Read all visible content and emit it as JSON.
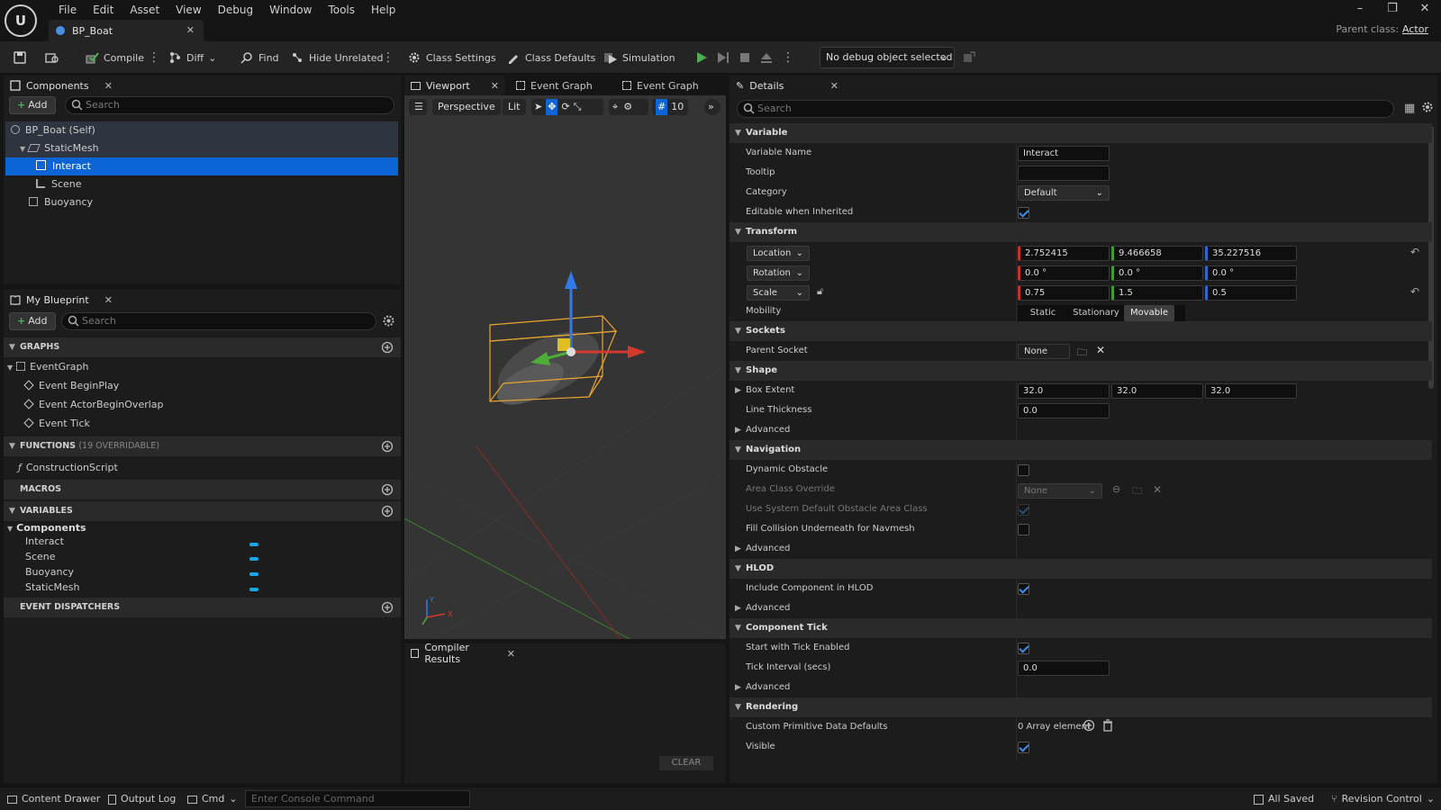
{
  "menu": [
    "File",
    "Edit",
    "Asset",
    "View",
    "Debug",
    "Window",
    "Tools",
    "Help"
  ],
  "document_tab": "BP_Boat",
  "parent_class": {
    "label": "Parent class:",
    "value": "Actor"
  },
  "toolbar": {
    "compile": "Compile",
    "diff": "Diff",
    "find": "Find",
    "hide_unrelated": "Hide Unrelated",
    "class_settings": "Class Settings",
    "class_defaults": "Class Defaults",
    "simulation": "Simulation",
    "debug_object": "No debug object selected"
  },
  "components": {
    "tab": "Components",
    "add": "Add",
    "search_placeholder": "Search",
    "tree": [
      {
        "label": "BP_Boat (Self)"
      },
      {
        "label": "StaticMesh"
      },
      {
        "label": "Interact"
      },
      {
        "label": "Scene"
      },
      {
        "label": "Buoyancy"
      }
    ]
  },
  "my_blueprint": {
    "tab": "My Blueprint",
    "add": "Add",
    "search_placeholder": "Search",
    "graphs": "GRAPHS",
    "event_graph": "EventGraph",
    "events": [
      "Event BeginPlay",
      "Event ActorBeginOverlap",
      "Event Tick"
    ],
    "functions": "FUNCTIONS",
    "functions_count": "(19 OVERRIDABLE)",
    "construction": "ConstructionScript",
    "macros": "MACROS",
    "variables": "VARIABLES",
    "components_group": "Components",
    "vars": [
      "Interact",
      "Scene",
      "Buoyancy",
      "StaticMesh"
    ],
    "event_dispatchers": "EVENT DISPATCHERS"
  },
  "center_tabs": [
    "Viewport",
    "Event Graph",
    "Event Graph"
  ],
  "viewport": {
    "perspective": "Perspective",
    "lit": "Lit",
    "grid_size": "10",
    "axis_x": "X",
    "axis_y": "Y"
  },
  "compiler": {
    "tab": "Compiler Results",
    "clear": "CLEAR"
  },
  "details": {
    "tab": "Details",
    "search_placeholder": "Search",
    "variable": "Variable",
    "variable_name_label": "Variable Name",
    "variable_name": "Interact",
    "tooltip_label": "Tooltip",
    "category_label": "Category",
    "category": "Default",
    "editable_label": "Editable when Inherited",
    "transform": "Transform",
    "location": "Location",
    "loc": [
      "2.752415",
      "9.466658",
      "35.227516"
    ],
    "rotation": "Rotation",
    "rot": [
      "0.0 °",
      "0.0 °",
      "0.0 °"
    ],
    "scale": "Scale",
    "scl": [
      "0.75",
      "1.5",
      "0.5"
    ],
    "mobility": "Mobility",
    "mobility_opts": [
      "Static",
      "Stationary",
      "Movable"
    ],
    "sockets": "Sockets",
    "parent_socket": "Parent Socket",
    "parent_socket_val": "None",
    "shape": "Shape",
    "box_extent": "Box Extent",
    "box": [
      "32.0",
      "32.0",
      "32.0"
    ],
    "line_thickness": "Line Thickness",
    "line_thickness_val": "0.0",
    "advanced": "Advanced",
    "navigation": "Navigation",
    "dynamic_obstacle": "Dynamic Obstacle",
    "area_class": "Area Class Override",
    "area_class_val": "None",
    "use_system": "Use System Default Obstacle Area Class",
    "fill_collision": "Fill Collision Underneath for Navmesh",
    "hlod": "HLOD",
    "include_hlod": "Include Component in HLOD",
    "component_tick": "Component Tick",
    "start_tick": "Start with Tick Enabled",
    "tick_interval": "Tick Interval (secs)",
    "tick_interval_val": "0.0",
    "rendering": "Rendering",
    "custom_prim": "Custom Primitive Data Defaults",
    "array_element": "0 Array element",
    "visible": "Visible"
  },
  "status": {
    "content_drawer": "Content Drawer",
    "output_log": "Output Log",
    "cmd": "Cmd",
    "console_placeholder": "Enter Console Command",
    "all_saved": "All Saved",
    "revision": "Revision Control"
  }
}
